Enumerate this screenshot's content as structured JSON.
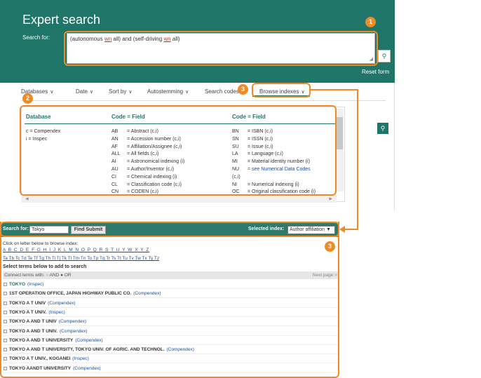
{
  "hero": {
    "title": "Expert search",
    "search_label": "Search for:",
    "query_before": "(autonomous ",
    "query_wn1": "wn",
    "query_mid": " all) and (self-driving ",
    "query_wn2": "wn",
    "query_after": " all)",
    "search_icon": "search-icon",
    "reset_form": "Reset form"
  },
  "options": {
    "databases": "Databases",
    "date": "Date",
    "sort_by": "Sort by",
    "autostemming": "Autostemming",
    "search_codes": "Search codes",
    "browse_indexes": "Browse indexes"
  },
  "codes": {
    "header_database": "Database",
    "header_code_field_1": "Code = Field",
    "header_code_field_2": "Code = Field",
    "databases": [
      "c     = Compendex",
      "i      = Inspec"
    ],
    "col2_codes": [
      "AB",
      "AN",
      "AF",
      "ALL",
      "AI",
      "AU",
      "CI",
      "CL",
      "CN"
    ],
    "col2_fields": [
      "= Abstract (c,i)",
      "= Accession number (c,i)",
      "= Affiliation/Assignee (c,i)",
      "= All fields (c,i)",
      "= Astronomical indexing (i)",
      "= Author/Inventor (c,i)",
      "= Chemical indexing (i)",
      "= Classification code (c,i)",
      "= CODEN (c,i)"
    ],
    "col3_codes": [
      "BN",
      "SN",
      "SU",
      "LA",
      "MI",
      "NU",
      "(c,i)",
      "NI",
      "OC"
    ],
    "col3_fields": [
      "= ISBN (c,i)",
      "= ISSN (c,i)",
      "= Issue (c,i)",
      "= Language (c,i)",
      "= Material identity number (i)",
      "= see Numerical Data Codes",
      "",
      "= Numerical indexing (i)",
      "= Original classification code (i)"
    ]
  },
  "badges": {
    "one": "1",
    "two": "2",
    "three_top": "3",
    "three_bottom": "3"
  },
  "browse": {
    "search_for_label": "Search for:",
    "search_value": "Tokyo",
    "find_submit": "Find Submit",
    "selected_index_label": "Selected index:",
    "selected_index_value": "Author affiliation ▼",
    "click_letter": "Click on letter below to browse index:",
    "letters": "A B C D E F G H I J K L M N O P Q R S T U Y W X Y Z",
    "letters2": "Ta Tb Tc Td Te Tf Tg Th Ti Tj Tk Tl Tm Tn To Tp Tq Tr Ts Tt Tu Tv Tw Tx Ty Tz",
    "select_terms": "Select terms below to add to search",
    "connect_terms": "Connect terms with: ○ AND ● OR",
    "next_page": "Next page >",
    "terms": [
      {
        "term": "TOKYO",
        "source": "(Inspec)"
      },
      {
        "term": "1ST OPERATION OFFICE, JAPAN HIGHWAY PUBLIC CO.",
        "source": "(Compendex)"
      },
      {
        "term": "TOKYO A T UNIV",
        "source": "(Compendex)"
      },
      {
        "term": "TOKYO A T UNIV.",
        "source": "(Inspec)"
      },
      {
        "term": "TOKYO A AND T UNIV",
        "source": "(Compendex)"
      },
      {
        "term": "TOKYO A AND T UNIV.",
        "source": "(Compendex)"
      },
      {
        "term": "TOKYO A AND T UNIVERSITY",
        "source": "(Compendex)"
      },
      {
        "term": "TOKYO A AND T UNIVERSITY, TOKYO UNIV. OF AGRIC. AND TECHNOL.",
        "source": "(Compendex)"
      },
      {
        "term": "TOKYO A T UNIV., KOGANEI",
        "source": "(Inspec)"
      },
      {
        "term": "TOKYO AANDT UNIVERSITY",
        "source": "(Compendex)"
      }
    ]
  },
  "colors": {
    "accent": "#1f7567",
    "annotation": "#f08a24",
    "link": "#1a4fa0"
  }
}
